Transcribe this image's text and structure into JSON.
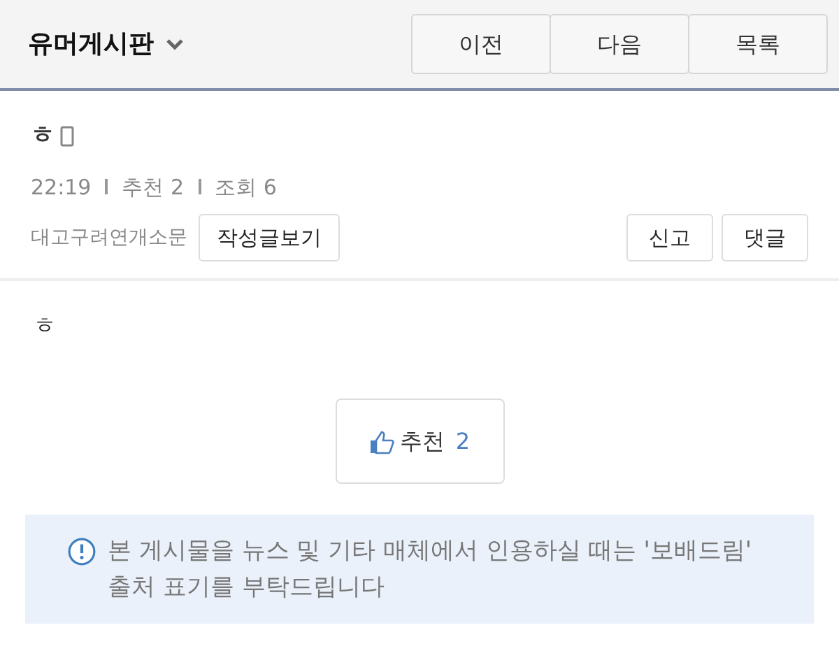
{
  "header": {
    "board": "유머게시판",
    "buttons": [
      "이전",
      "다음",
      "목록"
    ]
  },
  "post": {
    "title": "ㅎ",
    "meta": [
      "22:19",
      "추천 2",
      "조회 6"
    ],
    "author": "대고구려연개소문",
    "author_button": "작성글보기",
    "actions": [
      "신고",
      "댓글"
    ],
    "body": "ㅎ"
  },
  "like": {
    "label": "추천",
    "count": "2"
  },
  "notice": "본 게시물을 뉴스 및 기타 매체에서 인용하실 때는 '보배드림' 출처 표기를 부탁드립니다"
}
